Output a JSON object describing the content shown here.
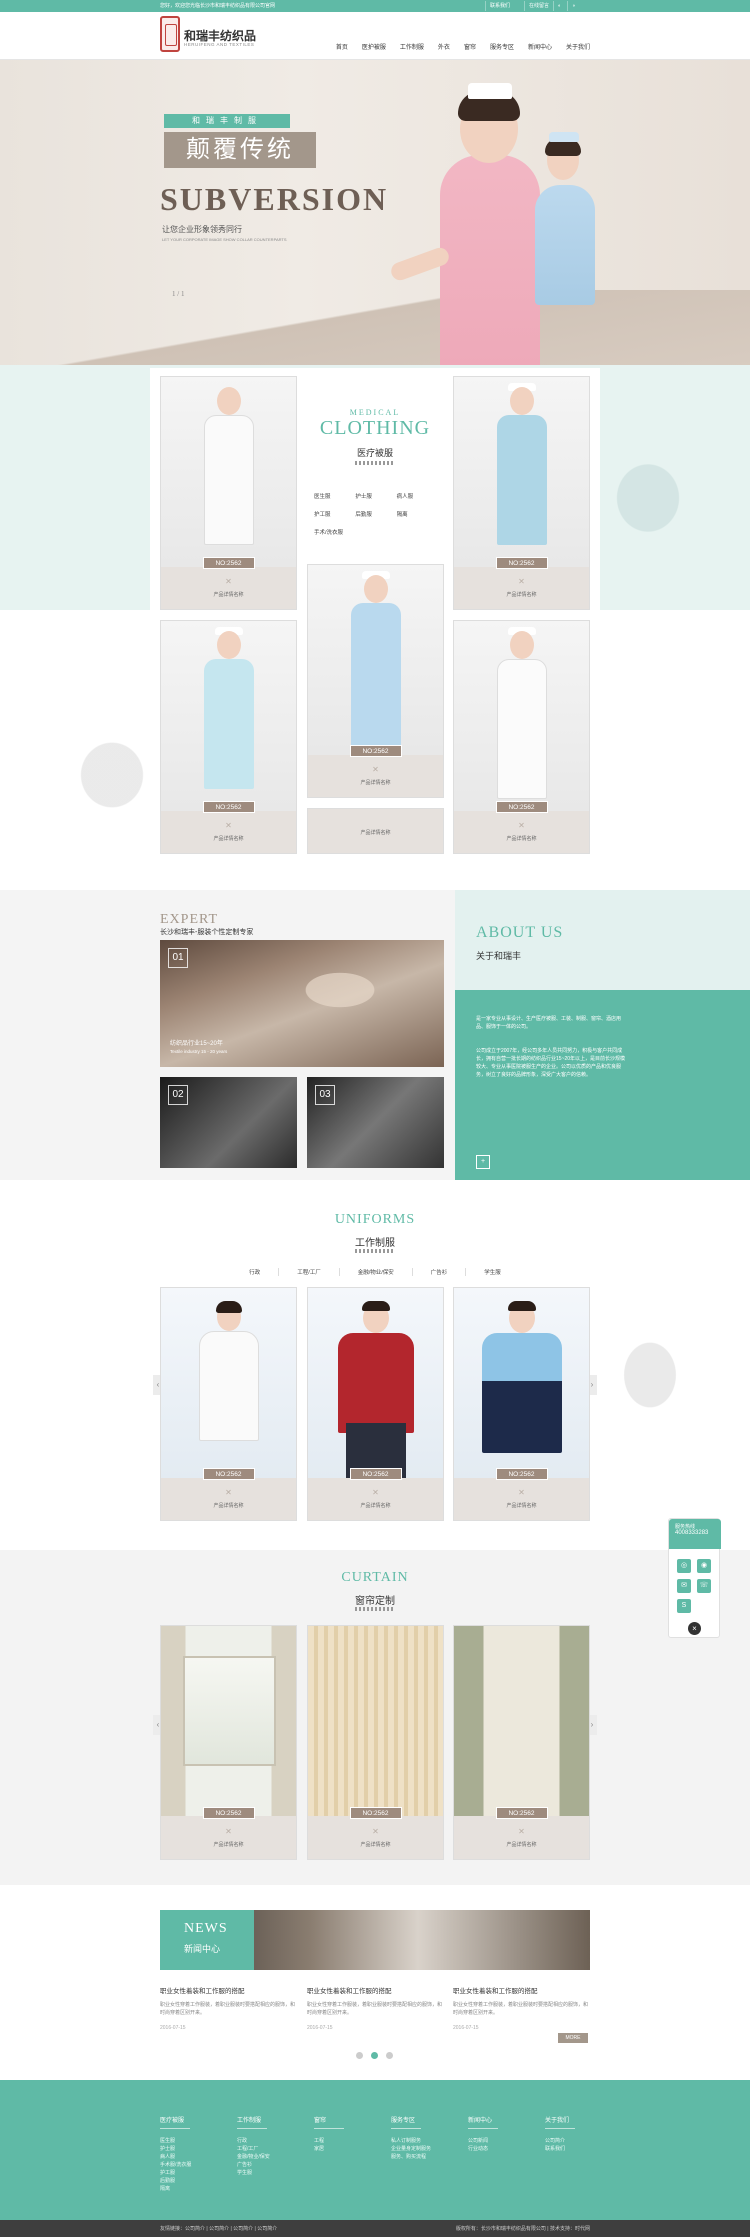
{
  "topbar": {
    "welcome": "您好，欢迎您光临长沙市和瑞丰纺织品有限公司官网",
    "links": [
      "联系我们",
      "在线留言",
      "",
      ""
    ]
  },
  "header": {
    "logo_name": "和瑞丰纺织品",
    "logo_en": "HERUIFENG AND TEXTILES",
    "nav": [
      "首页",
      "医护被服",
      "工作制服",
      "外衣",
      "窗帘",
      "服务专区",
      "新闻中心",
      "关于我们"
    ]
  },
  "banner": {
    "tag": "和瑞丰制服",
    "title": "颠覆传统",
    "title_en": "SUBVERSION",
    "subtitle": "让您企业形象领秀同行",
    "subtitle_en": "LET YOUR CORPORATE IMAGE SHOW COLLAR COUNTERPARTS",
    "page": "1 / 1"
  },
  "medical": {
    "en_small": "MEDICAL",
    "en": "CLOTHING",
    "cn": "医疗被服",
    "categories": [
      "医生服",
      "护士服",
      "病人服",
      "护工服",
      "后勤服",
      "隔离",
      "手术/洗衣服"
    ],
    "cards": [
      {
        "no": "NO:2562",
        "caption": "产品详情名称"
      },
      {
        "no": "NO:2562",
        "caption": "产品详情名称"
      },
      {
        "no": "NO:2562",
        "caption": "产品详情名称"
      },
      {
        "no": "NO:2562",
        "caption": "产品详情名称"
      },
      {
        "no": "NO:2562",
        "caption": "产品详情名称"
      },
      {
        "no": "",
        "caption": "产品详情名称"
      }
    ]
  },
  "expert": {
    "en": "EXPERT",
    "cn": "长沙和瑞丰-服装个性定制专家",
    "items": [
      {
        "num": "01",
        "caption1": "纺织品行业15~20年",
        "caption2": "Textile industry 15 - 20 years"
      },
      {
        "num": "02"
      },
      {
        "num": "03"
      }
    ]
  },
  "about": {
    "en": "ABOUT US",
    "cn": "关于和瑞丰",
    "p1": "是一家专业从事设计、生产医疗被服、工装、制服、窗帘、酒店用品、服饰于一体的公司。",
    "p2": "公司成立于2007年，经公司多年人员共同努力，积极与客户共同成长，拥有自营一批长期的纺织品行业15~20年以上，是目前长沙规模较大、专业从事医院被服生产的企业。公司以优质的产品和优良服务，树立了良好的品牌形象，深受广大客户的信赖。",
    "btn": "+"
  },
  "uniforms": {
    "en": "UNIFORMS",
    "cn": "工作制服",
    "tabs": [
      "行政",
      "工程/工厂",
      "金融/物业/保安",
      "广告衫",
      "学生服"
    ],
    "cards": [
      {
        "no": "NO:2562",
        "caption": "产品详情名称"
      },
      {
        "no": "NO:2562",
        "caption": "产品详情名称"
      },
      {
        "no": "NO:2562",
        "caption": "产品详情名称"
      }
    ]
  },
  "curtain": {
    "en": "CURTAIN",
    "cn": "窗帘定制",
    "cards": [
      {
        "no": "NO:2562",
        "caption": "产品详情名称"
      },
      {
        "no": "NO:2562",
        "caption": "产品详情名称"
      },
      {
        "no": "NO:2562",
        "caption": "产品详情名称"
      }
    ]
  },
  "news": {
    "en": "NEWS",
    "cn": "新闻中心",
    "items": [
      {
        "title": "职业女性着装和工作服的搭配",
        "desc": "职业女性穿着工作服装，着职业服装时要搭配相应的服饰，和时尚穿着区别开来。",
        "date": "2016-07-15"
      },
      {
        "title": "职业女性着装和工作服的搭配",
        "desc": "职业女性穿着工作服装，着职业服装时要搭配相应的服饰，和时尚穿着区别开来。",
        "date": "2016-07-15"
      },
      {
        "title": "职业女性着装和工作服的搭配",
        "desc": "职业女性穿着工作服装，着职业服装时要搭配相应的服饰，和时尚穿着区别开来。",
        "date": "2016-07-15"
      }
    ],
    "more": "MORE"
  },
  "footer": {
    "cols": [
      {
        "h": "医疗被服",
        "items": [
          "医生服",
          "护士服",
          "病人服",
          "手术服/洗衣服",
          "护工服",
          "后勤服",
          "隔离"
        ]
      },
      {
        "h": "工作制服",
        "items": [
          "行政",
          "工程/工厂",
          "金融/物业/保安",
          "广告衫",
          "学生服"
        ]
      },
      {
        "h": "窗帘",
        "items": [
          "工程",
          "家居"
        ]
      },
      {
        "h": "服务专区",
        "items": [
          "私人订制服务",
          "企业量身定制服务",
          "服务、购买流程"
        ]
      },
      {
        "h": "新闻中心",
        "items": [
          "公司新闻",
          "行业动态"
        ]
      },
      {
        "h": "关于我们",
        "items": [
          "公司简介",
          "联系我们"
        ]
      }
    ],
    "bottom_left": "友情链接：公司简介  |  公司简介  |  公司简介  |  公司简介",
    "bottom_right": "版权所有：长沙市和瑞丰纺织品有限公司  |  技术支持：时代网"
  },
  "float": {
    "label": "服务热线",
    "tel": "4008333283",
    "close": "×"
  },
  "colors": {
    "accent": "#5fbaa6",
    "taupe": "#a3978b",
    "seal": "#c0443f"
  }
}
